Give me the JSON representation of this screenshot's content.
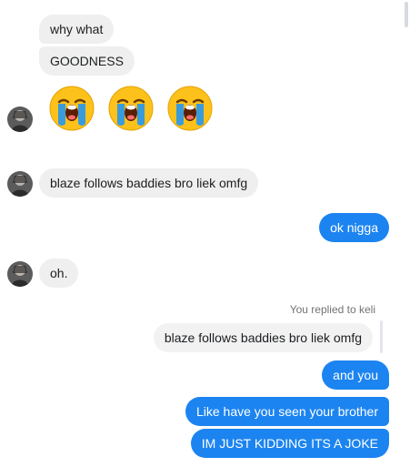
{
  "messages": {
    "m1": "why what",
    "m2": "GOODNESS",
    "emoji": [
      "loudly-crying-face",
      "loudly-crying-face",
      "loudly-crying-face"
    ],
    "m3": "blaze follows baddies bro liek omfg",
    "m4": "ok nigga",
    "m5": "oh.",
    "reply_label": "You replied to keli",
    "quoted": "blaze follows baddies bro liek omfg",
    "m6": "and you",
    "m7": "Like have you seen your brother",
    "m8": "IM JUST KIDDING ITS A JOKE"
  },
  "colors": {
    "outgoing_bubble": "#1c84f0",
    "incoming_bubble": "#efefef"
  }
}
